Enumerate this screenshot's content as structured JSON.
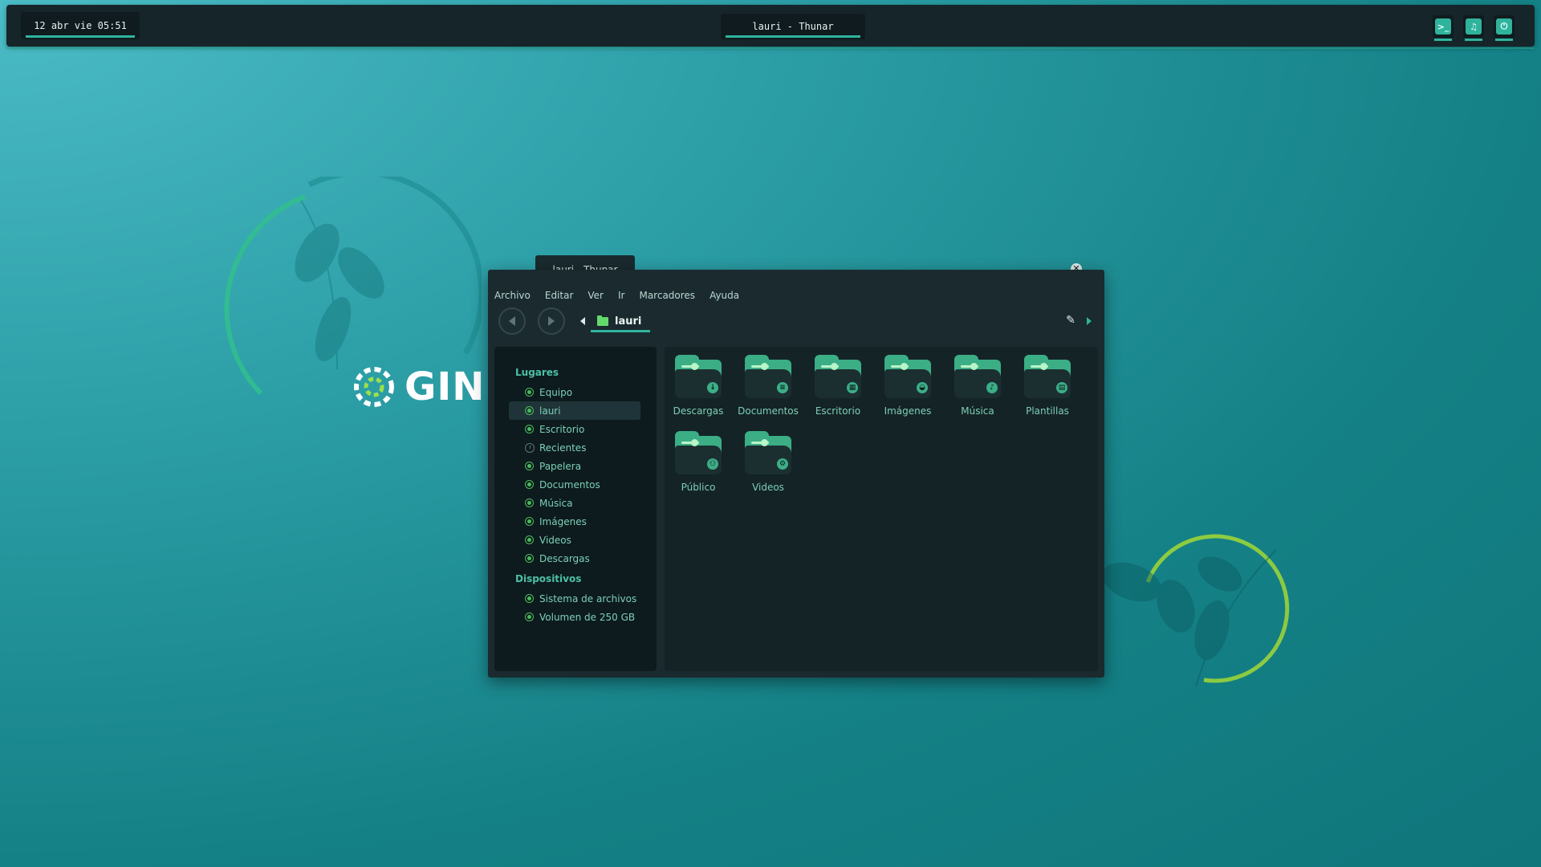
{
  "panel": {
    "clock": "12 abr vie 05:51",
    "active_window": "lauri - Thunar",
    "buttons": [
      {
        "name": "terminal-icon",
        "glyph": ">_"
      },
      {
        "name": "music-icon",
        "glyph": "♫"
      },
      {
        "name": "power-icon",
        "glyph": "⏻"
      }
    ]
  },
  "wallpaper": {
    "logo_text": "GIN"
  },
  "window": {
    "title": "lauri - Thunar",
    "menu": [
      "Archivo",
      "Editar",
      "Ver",
      "Ir",
      "Marcadores",
      "Ayuda"
    ],
    "path_current": "lauri"
  },
  "sidebar": {
    "places_header": "Lugares",
    "places": [
      {
        "label": "Equipo",
        "icon": "dot"
      },
      {
        "label": "lauri",
        "icon": "dot",
        "active": true
      },
      {
        "label": "Escritorio",
        "icon": "dot"
      },
      {
        "label": "Recientes",
        "icon": "clock"
      },
      {
        "label": "Papelera",
        "icon": "dot"
      },
      {
        "label": "Documentos",
        "icon": "dot"
      },
      {
        "label": "Música",
        "icon": "dot"
      },
      {
        "label": "Imágenes",
        "icon": "dot"
      },
      {
        "label": "Videos",
        "icon": "dot"
      },
      {
        "label": "Descargas",
        "icon": "dot"
      }
    ],
    "devices_header": "Dispositivos",
    "devices": [
      {
        "label": "Sistema de archivos",
        "icon": "dot"
      },
      {
        "label": "Volumen de 250 GB",
        "icon": "dot"
      }
    ]
  },
  "folders": [
    {
      "label": "Descargas",
      "badge": "↓"
    },
    {
      "label": "Documentos",
      "badge": "≡"
    },
    {
      "label": "Escritorio",
      "badge": "▦"
    },
    {
      "label": "Imágenes",
      "badge": "◒"
    },
    {
      "label": "Música",
      "badge": "♪"
    },
    {
      "label": "Plantillas",
      "badge": "▤"
    },
    {
      "label": "Público",
      "badge": "⚇"
    },
    {
      "label": "Videos",
      "badge": "⚙"
    }
  ],
  "colors": {
    "accent": "#2fb39c",
    "folder_top": "#3cae86",
    "panel_bg": "#16252a",
    "window_bg": "#1a2a2e"
  }
}
